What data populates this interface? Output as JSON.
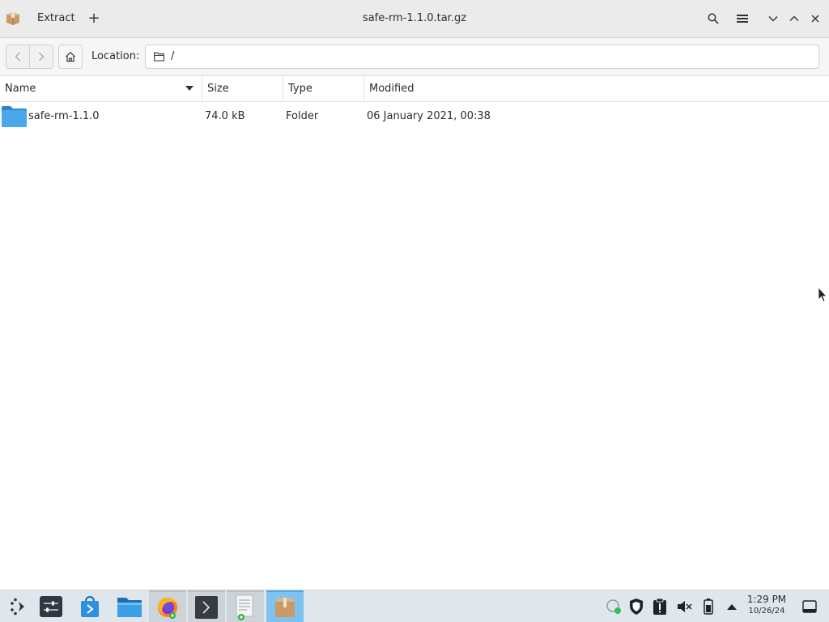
{
  "header": {
    "app_icon": "package-icon",
    "extract_label": "Extract",
    "add_icon": "plus-icon",
    "title": "safe-rm-1.1.0.tar.gz",
    "search_icon": "search-icon",
    "menu_icon": "hamburger-menu-icon",
    "minimize_icon": "chevron-down-icon",
    "maximize_icon": "chevron-up-icon",
    "close_icon": "close-icon"
  },
  "toolbar": {
    "back_icon": "chevron-left-icon",
    "forward_icon": "chevron-right-icon",
    "home_icon": "home-icon",
    "location_label": "Location:",
    "location_value": "/"
  },
  "columns": {
    "name": "Name",
    "size": "Size",
    "type": "Type",
    "modified": "Modified",
    "sort": "descending"
  },
  "files": [
    {
      "name": "safe-rm-1.1.0",
      "size": "74.0 kB",
      "type": "Folder",
      "modified": "06 January 2021, 00:38",
      "icon": "folder-icon"
    }
  ],
  "taskbar": {
    "items": [
      {
        "name": "app-launcher",
        "icon": "launcher-icon"
      },
      {
        "name": "settings-app",
        "icon": "settings-sliders-icon"
      },
      {
        "name": "software-store",
        "icon": "store-bag-icon"
      },
      {
        "name": "file-manager",
        "icon": "folder-icon"
      },
      {
        "name": "firefox",
        "icon": "firefox-icon"
      },
      {
        "name": "terminal",
        "icon": "terminal-icon"
      },
      {
        "name": "text-editor",
        "icon": "text-editor-icon"
      },
      {
        "name": "archive-manager",
        "icon": "package-icon"
      }
    ],
    "tray": [
      "network-icon",
      "shield-icon",
      "clipboard-icon",
      "volume-muted-icon",
      "battery-icon",
      "chevron-up-icon"
    ],
    "time": "1:29 PM",
    "date": "10/26/24",
    "accent": "#7ec2ef"
  },
  "colors": {
    "headerbar": "#ebebeb",
    "folder": "#3d9ee2",
    "taskbar": "#dfe6ec"
  }
}
